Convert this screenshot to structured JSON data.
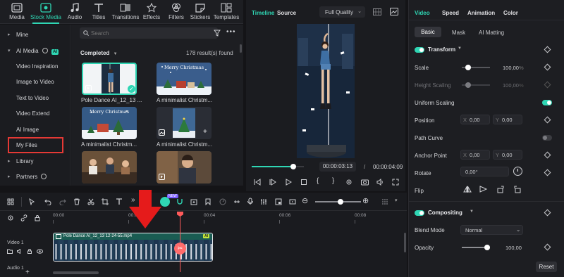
{
  "top_tabs": [
    {
      "label": "Media",
      "icon": "media-icon"
    },
    {
      "label": "Stock Media",
      "icon": "stock-media-icon"
    },
    {
      "label": "Audio",
      "icon": "audio-icon"
    },
    {
      "label": "Titles",
      "icon": "titles-icon"
    },
    {
      "label": "Transitions",
      "icon": "transitions-icon"
    },
    {
      "label": "Effects",
      "icon": "effects-icon"
    },
    {
      "label": "Filters",
      "icon": "filters-icon"
    },
    {
      "label": "Stickers",
      "icon": "stickers-icon"
    },
    {
      "label": "Templates",
      "icon": "templates-icon"
    }
  ],
  "sidebar": {
    "items": [
      {
        "label": "Mine"
      },
      {
        "label": "AI Media",
        "badge": "AI"
      },
      {
        "label": "Video Inspiration"
      },
      {
        "label": "Image to Video"
      },
      {
        "label": "Text to Video"
      },
      {
        "label": "Video Extend"
      },
      {
        "label": "AI Image"
      },
      {
        "label": "My Files"
      },
      {
        "label": "Library"
      },
      {
        "label": "Partners"
      }
    ]
  },
  "media": {
    "search_placeholder": "Search",
    "filter_label": "Completed",
    "result_count": "178 result(s) found",
    "items": [
      {
        "caption": "Pole Dance AI_12_13 ...",
        "selected": true
      },
      {
        "caption": "A minimalist Christm...",
        "thumb_text": "Merry Christmas"
      },
      {
        "caption": "A minimalist Christm...",
        "thumb_text": "Merry Christmas"
      },
      {
        "caption": "A minimalist Christm..."
      },
      {
        "caption": ""
      },
      {
        "caption": ""
      }
    ]
  },
  "preview": {
    "tab_timeline": "Timeline",
    "tab_source": "Source",
    "quality": "Full Quality",
    "current_time": "00:00:03:13",
    "separator": "/",
    "total_time": "00:00:04:09",
    "progress": 0.8
  },
  "props": {
    "tabs": [
      "Video",
      "Speed",
      "Animation",
      "Color"
    ],
    "subtabs": [
      "Basic",
      "Mask",
      "AI Matting"
    ],
    "transform_title": "Transform",
    "scale_label": "Scale",
    "scale_value": "100,00",
    "scale_unit": "%",
    "height_label": "Height Scaling",
    "height_value": "100,00",
    "height_unit": "%",
    "uniform_label": "Uniform Scaling",
    "position_label": "Position",
    "pos_x_label": "X",
    "pos_x": "0,00",
    "pos_y_label": "Y",
    "pos_y": "0,00",
    "pos_unit": "px",
    "path_curve_label": "Path Curve",
    "anchor_label": "Anchor Point",
    "anchor_x": "0,00",
    "anchor_y": "0,00",
    "rotate_label": "Rotate",
    "rotate_value": "0,00°",
    "flip_label": "Flip",
    "compositing_title": "Compositing",
    "blend_label": "Blend Mode",
    "blend_value": "Normal",
    "opacity_label": "Opacity",
    "opacity_value": "100,00",
    "reset_label": "Reset"
  },
  "timeline": {
    "ruler_labels": [
      "00:00",
      "00:02",
      "00:04",
      "00:06",
      "00:08"
    ],
    "clip_name": "Pole Dance AI_12_13 12-24-55.mp4",
    "clip_badge": "AI",
    "track_video": "Video 1",
    "track_audio": "Audio 1",
    "badge_new": "NEW"
  },
  "colors": {
    "accent": "#2fd6b4",
    "highlight": "#e53935",
    "playhead": "#ff5a5a",
    "clip": "#1f6b5f"
  }
}
